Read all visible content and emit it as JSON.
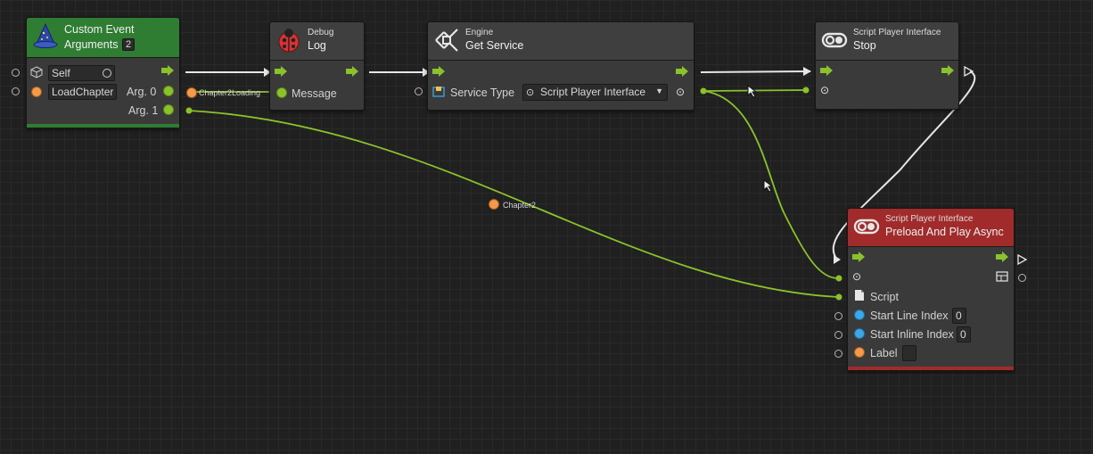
{
  "nodes": {
    "custom_event": {
      "title": "Custom Event",
      "subtitle": "Arguments",
      "arg_count": "2",
      "self_value": "Self",
      "name_value": "LoadChapter",
      "arg0": "Arg. 0",
      "arg1": "Arg. 1"
    },
    "debug_log": {
      "category": "Debug",
      "title": "Log",
      "message": "Message"
    },
    "get_service": {
      "category": "Engine",
      "title": "Get Service",
      "service_type_label": "Service Type",
      "service_type_value": "Script Player Interface"
    },
    "stop": {
      "category": "Script Player Interface",
      "title": "Stop"
    },
    "preload": {
      "category": "Script Player Interface",
      "title": "Preload And Play Async",
      "script": "Script",
      "start_line": "Start Line Index",
      "start_line_value": "0",
      "start_inline": "Start Inline Index",
      "start_inline_value": "0",
      "label": "Label"
    }
  },
  "labels": {
    "chapter2_loading": "Chapter2Loading",
    "chapter2": "Chapter2"
  },
  "colors": {
    "flow": "#e6e6e6",
    "data_wire": "#8bc22c",
    "event_header": "#2e7d32",
    "preload_header": "#a12a2a",
    "accent_green": "#8bc22c",
    "accent_orange": "#f49a4a",
    "accent_blue": "#3da8e8"
  },
  "icons": [
    "wizard-hat-icon",
    "ladybug-icon",
    "engine-service-icon",
    "script-player-icon",
    "cube-icon",
    "document-icon",
    "layout-icon",
    "cursor-icon"
  ]
}
